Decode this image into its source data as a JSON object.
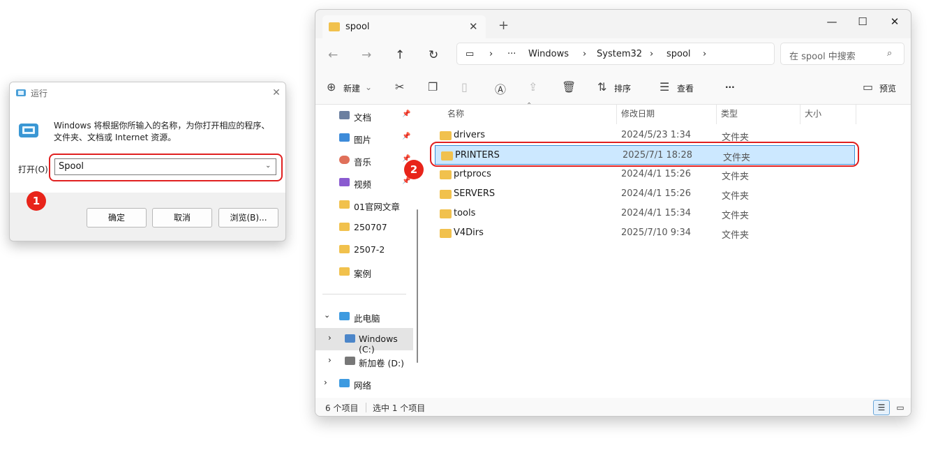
{
  "run": {
    "title": "运行",
    "description": "Windows 将根据你所输入的名称，为你打开相应的程序、文件夹、文档或 Internet 资源。",
    "open_label": "打开(O):",
    "input_value": "Spool",
    "ok": "确定",
    "cancel": "取消",
    "browse": "浏览(B)..."
  },
  "badges": {
    "one": "1",
    "two": "2"
  },
  "explorer": {
    "tab_title": "spool",
    "breadcrumb": [
      "Windows",
      "System32",
      "spool"
    ],
    "search_placeholder": "在 spool 中搜索",
    "toolbar": {
      "new": "新建",
      "sort": "排序",
      "view": "查看",
      "more": "···",
      "preview": "预览"
    },
    "columns": {
      "name": "名称",
      "modified": "修改日期",
      "type": "类型",
      "size": "大小"
    },
    "nav": {
      "documents": "文档",
      "pictures": "图片",
      "music": "音乐",
      "videos": "视频",
      "f1": "01官网文章",
      "f2": "250707",
      "f3": "2507-2",
      "f4": "案例",
      "thispc": "此电脑",
      "cdrive": "Windows (C:)",
      "ddrive": "新加卷 (D:)",
      "network": "网络"
    },
    "rows": [
      {
        "name": "drivers",
        "date": "2024/5/23 1:34",
        "type": "文件夹"
      },
      {
        "name": "PRINTERS",
        "date": "2025/7/1 18:28",
        "type": "文件夹"
      },
      {
        "name": "prtprocs",
        "date": "2024/4/1 15:26",
        "type": "文件夹"
      },
      {
        "name": "SERVERS",
        "date": "2024/4/1 15:26",
        "type": "文件夹"
      },
      {
        "name": "tools",
        "date": "2024/4/1 15:34",
        "type": "文件夹"
      },
      {
        "name": "V4Dirs",
        "date": "2025/7/10 9:34",
        "type": "文件夹"
      }
    ],
    "status": {
      "count": "6 个项目",
      "selected": "选中 1 个项目"
    },
    "accent": "#3b8fd6",
    "highlight": "#e02020"
  }
}
